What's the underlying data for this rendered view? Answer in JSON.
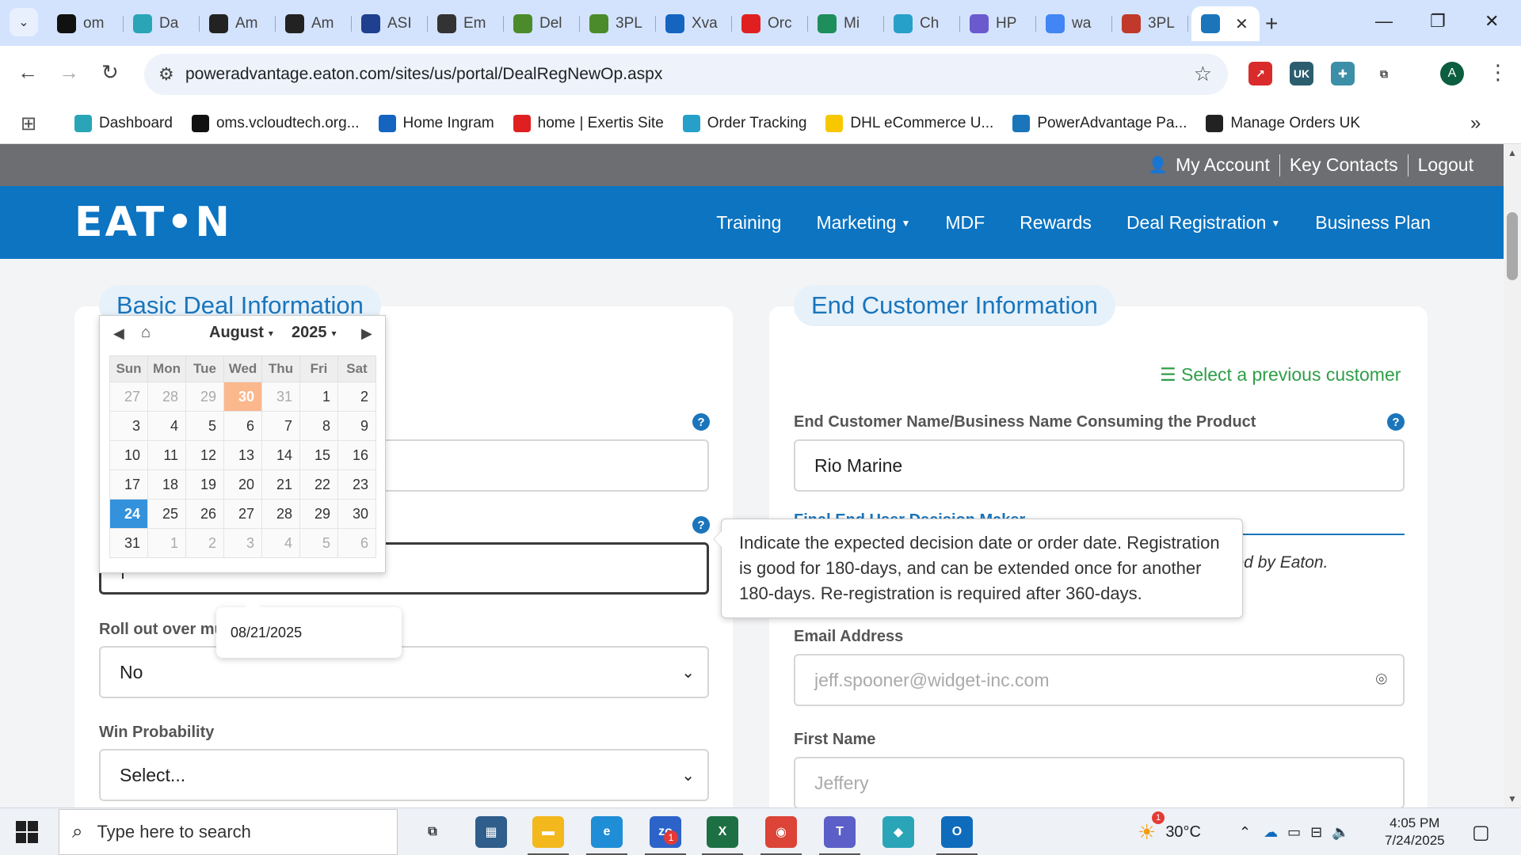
{
  "browser": {
    "tabs": [
      {
        "label": "om",
        "icon": "dark-triangle-icon",
        "color": "#111111"
      },
      {
        "label": "Da",
        "icon": "teal-gem-icon",
        "color": "#2aa5b8"
      },
      {
        "label": "Am",
        "icon": "amazon-icon",
        "color": "#222222"
      },
      {
        "label": "Am",
        "icon": "amazon-icon",
        "color": "#222222"
      },
      {
        "label": "ASI",
        "icon": "asi-arrow-icon",
        "color": "#1f3f8f"
      },
      {
        "label": "Em",
        "icon": "openai-icon",
        "color": "#333333"
      },
      {
        "label": "Del",
        "icon": "green-chart-icon",
        "color": "#4b8b2b"
      },
      {
        "label": "3PL",
        "icon": "green-chart-icon",
        "color": "#4b8b2b"
      },
      {
        "label": "Xva",
        "icon": "xvantage-icon",
        "color": "#1565c0"
      },
      {
        "label": "Orc",
        "icon": "exertis-icon",
        "color": "#e02020"
      },
      {
        "label": "Mi",
        "icon": "green-circle-icon",
        "color": "#1e8e5a"
      },
      {
        "label": "Ch",
        "icon": "c-circle-icon",
        "color": "#26a0c9"
      },
      {
        "label": "HP",
        "icon": "hp-icon",
        "color": "#6a5acd"
      },
      {
        "label": "wa",
        "icon": "google-icon",
        "color": "#4285f4"
      },
      {
        "label": "3PL",
        "icon": "shore-icon",
        "color": "#c0392b"
      }
    ],
    "active_tab": {
      "label": "",
      "icon": "poweradvantage-icon",
      "color": "#1a75bb"
    },
    "new_tab": "+",
    "window_controls": {
      "minimize": "—",
      "restore": "❐",
      "close": "✕"
    },
    "url": "poweradvantage.eaton.com/sites/us/portal/DealRegNewOp.aspx",
    "avatar_letter": "A",
    "extensions": [
      {
        "icon": "pdf-icon",
        "color": "#d92b2b",
        "text": "↗"
      },
      {
        "icon": "uk-badge-icon",
        "color": "#2b5d6e",
        "text": "UK"
      },
      {
        "icon": "teal-plus-icon",
        "color": "#3c8fa6",
        "text": "✚"
      },
      {
        "icon": "puzzle-icon",
        "color": "#ffffff",
        "text": "⧉"
      }
    ]
  },
  "bookmarks": [
    {
      "label": "Dashboard",
      "icon": "teal-gem-icon",
      "color": "#2aa5b8"
    },
    {
      "label": "oms.vcloudtech.org...",
      "icon": "dark-triangle-icon",
      "color": "#111111"
    },
    {
      "label": "Home Ingram",
      "icon": "ingram-icon",
      "color": "#1565c0"
    },
    {
      "label": "home | Exertis Site",
      "icon": "exertis-icon",
      "color": "#e02020"
    },
    {
      "label": "Order Tracking",
      "icon": "c-circle-icon",
      "color": "#26a0c9"
    },
    {
      "label": "DHL eCommerce U...",
      "icon": "dhl-icon",
      "color": "#f7c800"
    },
    {
      "label": "PowerAdvantage Pa...",
      "icon": "poweradvantage-icon",
      "color": "#1a75bb"
    },
    {
      "label": "Manage Orders UK",
      "icon": "amazon-icon",
      "color": "#222222"
    }
  ],
  "site": {
    "utility_links": [
      "My Account",
      "Key Contacts",
      "Logout"
    ],
    "logo_text": "EAT•N",
    "nav": [
      {
        "label": "Training",
        "dropdown": false
      },
      {
        "label": "Marketing",
        "dropdown": true
      },
      {
        "label": "MDF",
        "dropdown": false
      },
      {
        "label": "Rewards",
        "dropdown": false
      },
      {
        "label": "Deal Registration",
        "dropdown": true
      },
      {
        "label": "Business Plan",
        "dropdown": false
      }
    ],
    "brand_color": "#0c74c1"
  },
  "basic_deal": {
    "title": "Basic Deal Information",
    "date_input_value": "|",
    "rollout_label": "Roll out over mul",
    "rollout_value": "No",
    "win_probability_label": "Win Probability",
    "win_probability_value": "Select..."
  },
  "calendar": {
    "month": "August",
    "year": "2025",
    "weekdays": [
      "Sun",
      "Mon",
      "Tue",
      "Wed",
      "Thu",
      "Fri",
      "Sat"
    ],
    "weeks": [
      [
        "27",
        "28",
        "29",
        "30",
        "31",
        "1",
        "2"
      ],
      [
        "3",
        "4",
        "5",
        "6",
        "7",
        "8",
        "9"
      ],
      [
        "10",
        "11",
        "12",
        "13",
        "14",
        "15",
        "16"
      ],
      [
        "17",
        "18",
        "19",
        "20",
        "21",
        "22",
        "23"
      ],
      [
        "24",
        "25",
        "26",
        "27",
        "28",
        "29",
        "30"
      ],
      [
        "31",
        "1",
        "2",
        "3",
        "4",
        "5",
        "6"
      ]
    ],
    "today": "30",
    "selected": "24",
    "hover_date": "08/21/2025"
  },
  "help_tooltip": "Indicate the expected decision date or order date. Registration is good for 180-days, and can be extended once for another 180-days. Re-registration is required after 360-days.",
  "end_customer": {
    "title": "End Customer Information",
    "select_previous": "Select a previous customer",
    "name_label": "End Customer Name/Business Name Consuming the Product",
    "name_value": "Rio Marine",
    "hidden_label": "Final End User Decision Maker",
    "italic_note": "ved by Eaton.",
    "email_label": "Email Address",
    "email_placeholder": "jeff.spooner@widget-inc.com",
    "first_name_label": "First Name",
    "first_name_placeholder": "Jeffery"
  },
  "taskbar": {
    "search_placeholder": "Type here to search",
    "weather": "30°C",
    "time": "4:05 PM",
    "date": "7/24/2025",
    "apps": [
      {
        "icon": "task-view-icon",
        "color": "#333333",
        "text": "⧉"
      },
      {
        "icon": "calculator-icon",
        "color": "#2f5d8c",
        "text": "▦"
      },
      {
        "icon": "file-explorer-icon",
        "color": "#f3b81c",
        "text": "▬"
      },
      {
        "icon": "edge-icon",
        "color": "#1f8ed6",
        "text": "e"
      },
      {
        "icon": "zoho-icon",
        "color": "#2c63c9",
        "text": "zo"
      },
      {
        "icon": "excel-icon",
        "color": "#1d7044",
        "text": "X"
      },
      {
        "icon": "chrome-icon",
        "color": "#db4437",
        "text": "◉"
      },
      {
        "icon": "teams-icon",
        "color": "#5b5fc7",
        "text": "T"
      },
      {
        "icon": "gem-app-icon",
        "color": "#2aa5b8",
        "text": "◆"
      },
      {
        "icon": "outlook-icon",
        "color": "#0f6cbd",
        "text": "O"
      }
    ],
    "zoho_badge": "1",
    "weather_badge": "1"
  }
}
